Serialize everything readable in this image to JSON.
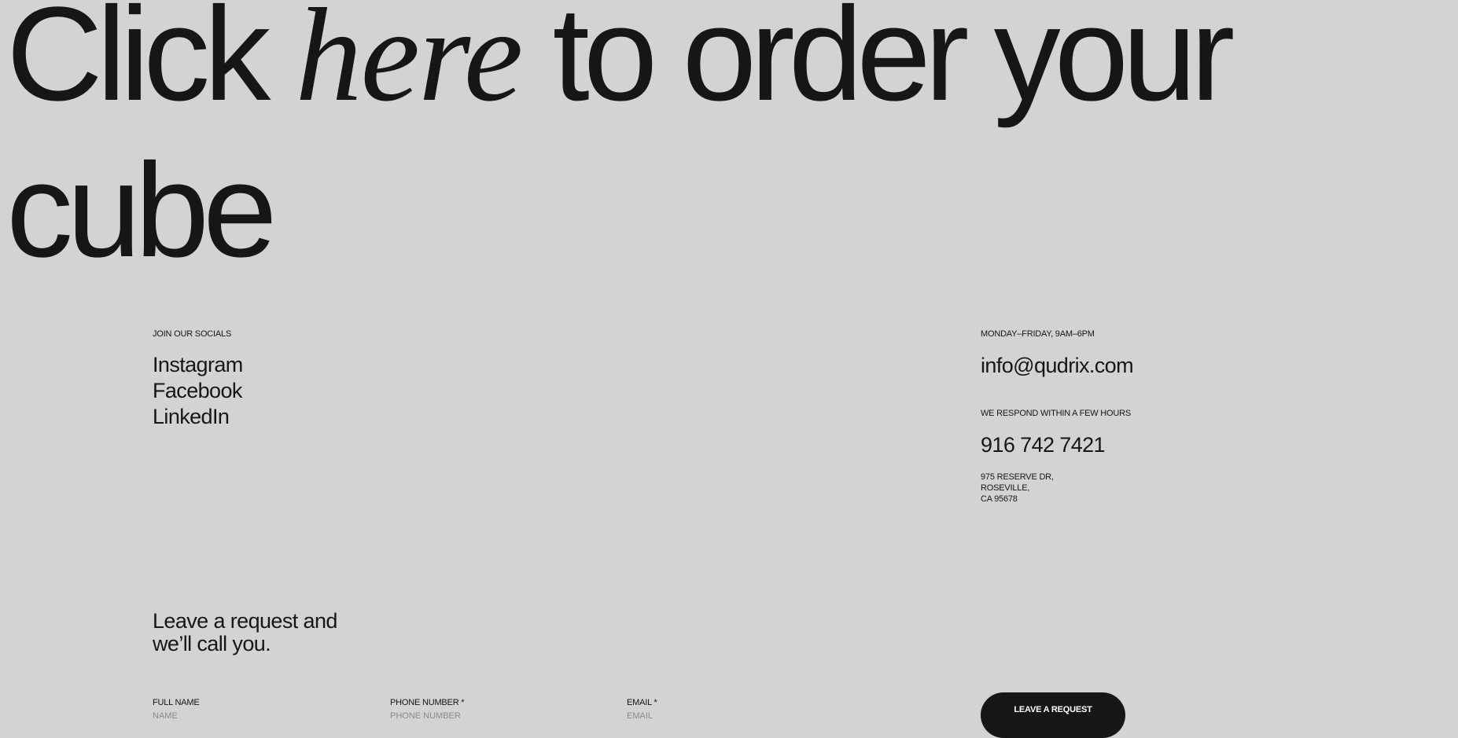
{
  "hero": {
    "word_click": "Click",
    "word_here": "here",
    "words_rest": "to order your",
    "line2": "cube"
  },
  "socials": {
    "label": "JOIN OUR SOCIALS",
    "links": [
      {
        "label": "Instagram"
      },
      {
        "label": "Facebook"
      },
      {
        "label": "LinkedIn"
      }
    ]
  },
  "contact": {
    "hours": "MONDAY–FRIDAY, 9AM–6PM",
    "email": "info@qudrix.com",
    "response_note": "WE RESPOND WITHIN A FEW HOURS",
    "phone": "916 742 7421",
    "address_lines": [
      "975 RESERVE DR,",
      "ROSEVILLE,",
      "CA 95678"
    ]
  },
  "request_form": {
    "title_line1": "Leave a request and",
    "title_line2": "we’ll call you.",
    "fields": [
      {
        "label": "FULL NAME",
        "placeholder": "NAME",
        "value": ""
      },
      {
        "label": "PHONE NUMBER *",
        "placeholder": "PHONE NUMBER",
        "value": ""
      },
      {
        "label": "EMAIL *",
        "placeholder": "EMAIL",
        "value": ""
      }
    ],
    "submit_label": "LEAVE A REQUEST"
  },
  "colors": {
    "background": "#d3d3d3",
    "text": "#161616",
    "button_bg": "#161616",
    "button_text": "#ffffff",
    "placeholder": "#8a8a8a"
  }
}
